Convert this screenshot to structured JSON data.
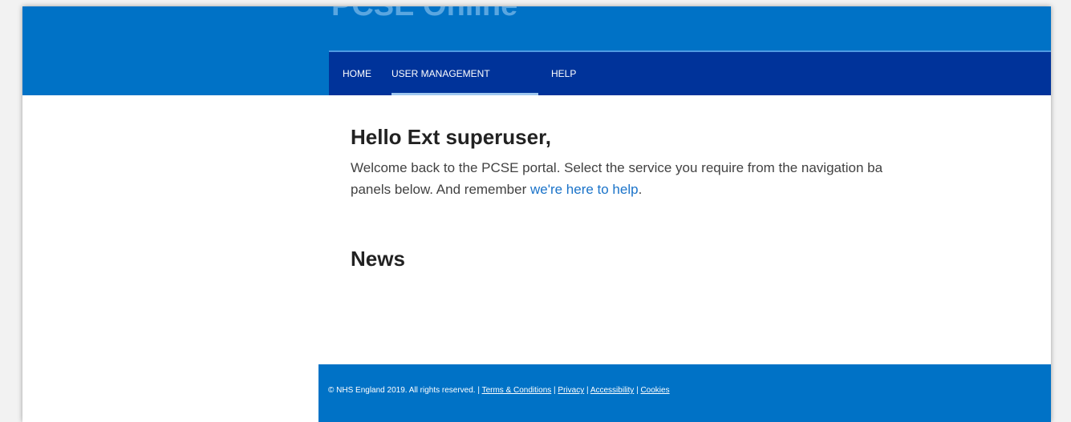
{
  "header": {
    "site_title": "PCSE Online"
  },
  "nav": {
    "items": [
      {
        "label": "HOME"
      },
      {
        "label": "USER MANAGEMENT"
      },
      {
        "label": "HELP"
      }
    ],
    "active": "USER MANAGEMENT"
  },
  "main": {
    "greeting": "Hello Ext superuser,",
    "welcome_text": "Welcome back to the PCSE portal. Select the service you require from the navigation ba",
    "welcome_text_line2": "panels below. And remember ",
    "help_link": "we're here to help",
    "welcome_end": ".",
    "news_heading": "News"
  },
  "footer": {
    "copyright": "© NHS England 2019. All rights reserved. | ",
    "links": [
      {
        "label": "Terms & Conditions"
      },
      {
        "label": "Privacy"
      },
      {
        "label": "Accessibility"
      },
      {
        "label": "Cookies"
      }
    ],
    "separator": " | "
  },
  "colors": {
    "header_blue": "#0072c6",
    "nav_dark_blue": "#00339a",
    "link_blue": "#1a73c9",
    "active_underline": "#9fc8f0"
  }
}
